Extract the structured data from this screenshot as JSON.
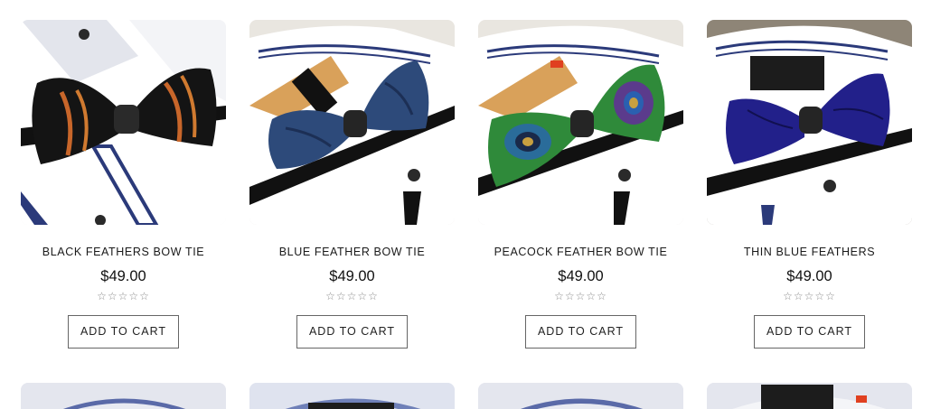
{
  "products": [
    {
      "title": "BLACK FEATHERS BOW TIE",
      "price": "$49.00",
      "rating_stars": "☆☆☆☆☆",
      "rating": 0,
      "button_label": "ADD TO CART",
      "image_icon": "black-feather-bow-tie-image"
    },
    {
      "title": "BLUE FEATHER BOW TIE",
      "price": "$49.00",
      "rating_stars": "☆☆☆☆☆",
      "rating": 0,
      "button_label": "ADD TO CART",
      "image_icon": "blue-feather-bow-tie-image"
    },
    {
      "title": "PEACOCK FEATHER BOW TIE",
      "price": "$49.00",
      "rating_stars": "☆☆☆☆☆",
      "rating": 0,
      "button_label": "ADD TO CART",
      "image_icon": "peacock-feather-bow-tie-image"
    },
    {
      "title": "THIN BLUE FEATHERS",
      "price": "$49.00",
      "rating_stars": "☆☆☆☆☆",
      "rating": 0,
      "button_label": "ADD TO CART",
      "image_icon": "thin-blue-feathers-image"
    }
  ],
  "colors": {
    "shirt": "#f4f5f8",
    "collar_shadow": "#d9dbe4",
    "black_bow": "#141414",
    "orange_feather": "#c8662a",
    "blue_bow": "#2d4a7a",
    "peacock_green": "#2f8a3a",
    "peacock_purple": "#5b3b8c",
    "thin_blue": "#22208a"
  }
}
